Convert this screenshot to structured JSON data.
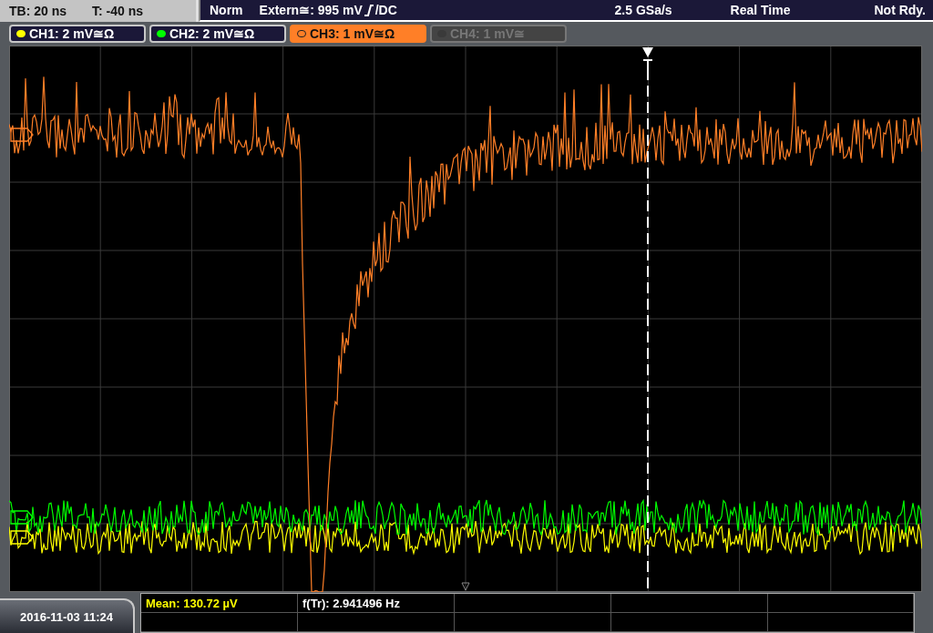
{
  "status": {
    "timebase": "TB: 20 ns",
    "trigger_time": "T: -40 ns",
    "mode": "Norm",
    "trigger_source": "Extern≅: 995 mV",
    "coupling": "/DC",
    "sample_rate": "2.5 GSa/s",
    "acquisition": "Real Time",
    "state": "Not Rdy."
  },
  "channels": [
    {
      "label": "CH1: 2 mV≅Ω",
      "color": "#ffff00",
      "selected": false,
      "on": true
    },
    {
      "label": "CH2: 2 mV≅Ω",
      "color": "#00ff00",
      "selected": false,
      "on": true
    },
    {
      "label": "CH3: 1 mV≅Ω",
      "color": "#ff7f27",
      "selected": true,
      "on": true
    },
    {
      "label": "CH4: 1 mV≅",
      "color": "#3a3a3a",
      "selected": false,
      "on": false
    }
  ],
  "measurements": [
    {
      "text": "Mean: 130.72 µV",
      "highlighted": true
    },
    {
      "text": "f(Tr): 2.941496 Hz",
      "highlighted": false
    }
  ],
  "date": "2016-11-03 11:24"
}
